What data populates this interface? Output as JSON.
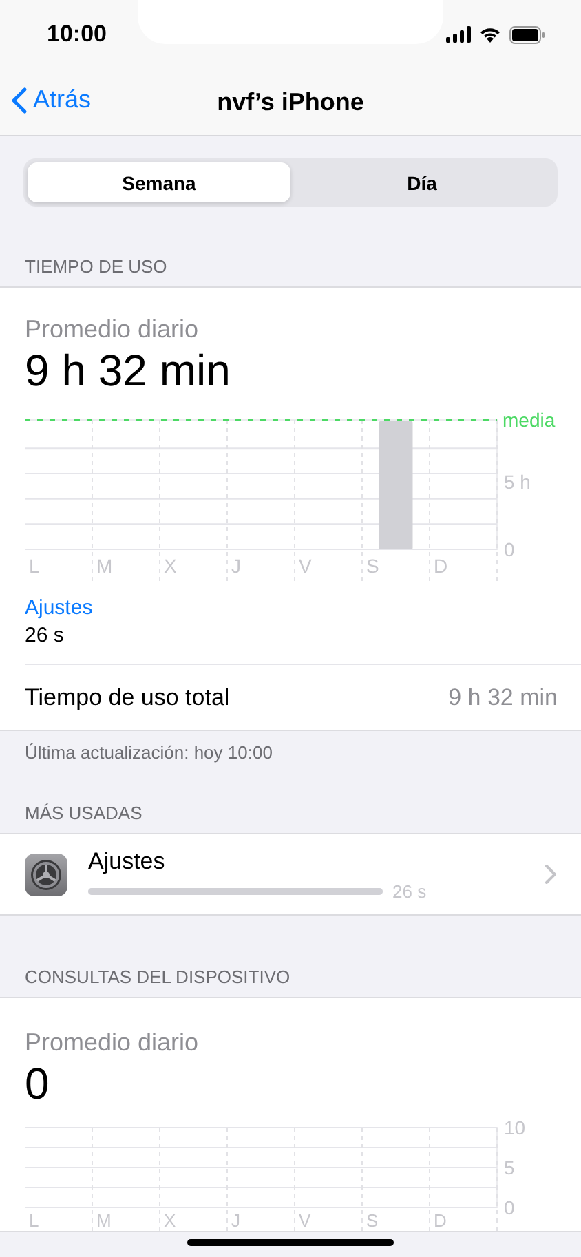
{
  "status_bar": {
    "time": "10:00"
  },
  "nav": {
    "back": "Atrás",
    "title": "nvf’s iPhone"
  },
  "tabs": [
    {
      "label": "Semana",
      "selected": true
    },
    {
      "label": "Día",
      "selected": false
    }
  ],
  "screen_time": {
    "header": "TIEMPO DE USO",
    "average_label": "Promedio diario",
    "average": "9 h 32 min",
    "chart_data": {
      "type": "bar",
      "categories": [
        "L",
        "M",
        "X",
        "J",
        "V",
        "S",
        "D"
      ],
      "values": [
        0,
        0,
        0,
        0,
        0,
        9.5,
        0
      ],
      "ylim": [
        0,
        9.6
      ],
      "yticks": [
        0,
        {
          "value": 5,
          "label": "5 h"
        }
      ],
      "ref_lines": [
        {
          "label": "media"
        }
      ]
    },
    "top_category": "Ajustes",
    "top_category_time": "26 s",
    "total_label": "Tiempo de uso total",
    "total": "9 h 32 min",
    "updated": "Última actualización: hoy 10:00"
  },
  "most_used": {
    "header": "MÁS USADAS",
    "apps": [
      {
        "name": "Ajustes",
        "time": "26 s",
        "level": 1
      }
    ]
  },
  "pickups": {
    "header": "CONSULTAS DEL DISPOSITIVO",
    "average_label": "Promedio diario",
    "average": "0",
    "chart_data": {
      "type": "bar",
      "categories": [
        "L",
        "M",
        "X",
        "J",
        "V",
        "S",
        "D"
      ],
      "values": [
        0,
        0,
        0,
        0,
        0,
        0,
        0
      ],
      "ylim": [
        0,
        10
      ],
      "yticks": [
        0,
        5,
        10
      ]
    }
  }
}
